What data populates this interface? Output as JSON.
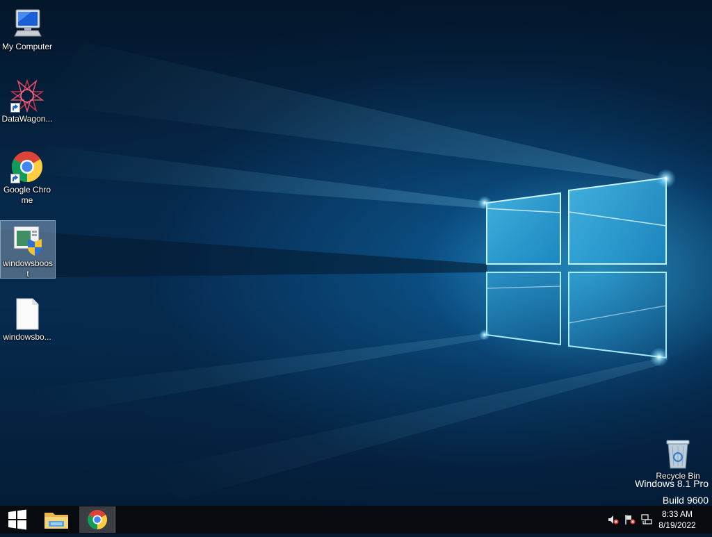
{
  "desktop": {
    "icons": [
      {
        "label": "My Computer",
        "icon": "computer-icon",
        "shortcut": false,
        "selected": false
      },
      {
        "label": "DataWagon...",
        "icon": "datawagon-star-icon",
        "shortcut": true,
        "selected": false
      },
      {
        "label": "Google Chrome",
        "icon": "chrome-icon",
        "shortcut": true,
        "selected": false
      },
      {
        "label": "windowsboost",
        "icon": "installer-shield-icon",
        "shortcut": false,
        "selected": true
      },
      {
        "label": "windowsbo...",
        "icon": "blank-file-icon",
        "shortcut": false,
        "selected": false
      }
    ],
    "recycle_bin": {
      "label": "Recycle Bin",
      "icon": "recycle-bin-icon"
    },
    "watermark": {
      "line1": "Windows 8.1 Pro",
      "line2": "Build 9600"
    }
  },
  "taskbar": {
    "start": {
      "icon": "windows-logo-icon"
    },
    "pinned": [
      {
        "name": "File Explorer",
        "icon": "folder-icon",
        "active": false
      },
      {
        "name": "Google Chrome",
        "icon": "chrome-icon",
        "active": true
      }
    ],
    "tray": [
      "speaker-muted-icon",
      "action-center-flag-icon",
      "network-icon"
    ],
    "clock": {
      "time": "8:33 AM",
      "date": "8/19/2022"
    }
  },
  "colors": {
    "taskbar_bg": "#070a0f",
    "selection": "#a0bedc",
    "accent_glow": "#5fd0ff"
  }
}
